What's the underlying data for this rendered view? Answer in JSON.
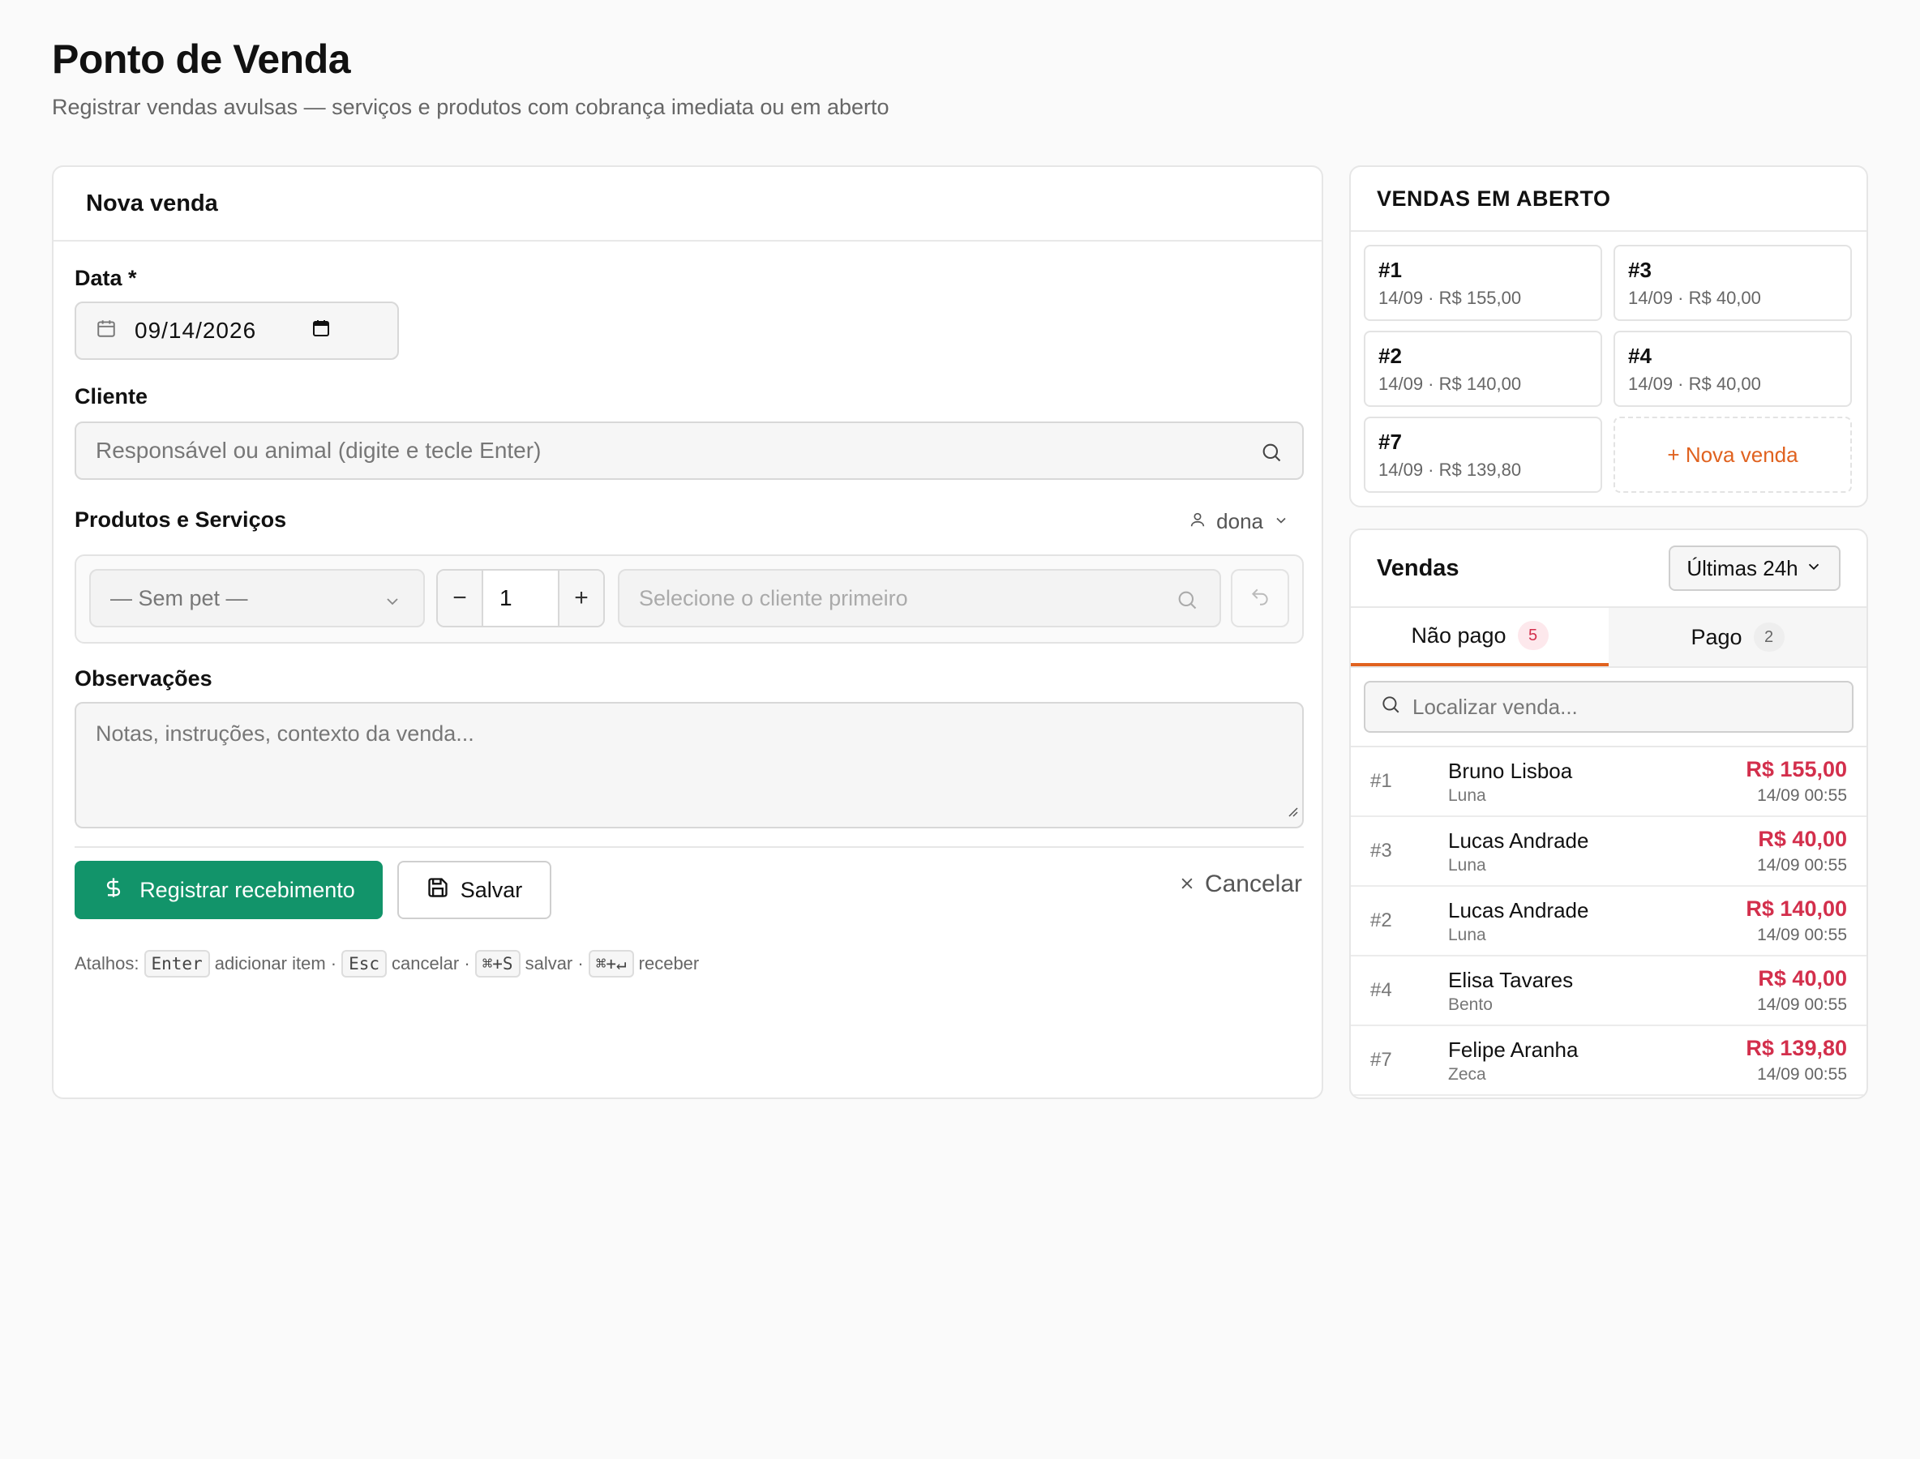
{
  "page": {
    "title": "Ponto de Venda",
    "subtitle": "Registrar vendas avulsas — serviços e produtos com cobrança imediata ou em aberto"
  },
  "new_sale": {
    "title": "Nova venda",
    "date_label": "Data *",
    "date_value": "09/14/2026",
    "client_label": "Cliente",
    "client_placeholder": "Responsável ou animal (digite e tecle Enter)",
    "items_label": "Produtos e Serviços",
    "owner_label": "dona",
    "pet_select": "— Sem pet —",
    "quantity": "1",
    "qty_minus": "−",
    "qty_plus": "+",
    "product_placeholder": "Selecione o cliente primeiro",
    "notes_label": "Observações",
    "notes_placeholder": "Notas, instruções, contexto da venda...",
    "register_label": "Registrar recebimento",
    "save_label": "Salvar",
    "cancel_label": "Cancelar",
    "shortcuts": {
      "prefix": "Atalhos:",
      "items": [
        {
          "key": "Enter",
          "text": "adicionar item ·"
        },
        {
          "key": "Esc",
          "text": "cancelar ·"
        },
        {
          "key": "⌘+S",
          "text": "salvar ·"
        },
        {
          "key": "⌘+↵",
          "text": "receber"
        }
      ]
    }
  },
  "open_sales": {
    "title": "VENDAS EM ABERTO",
    "tiles": [
      {
        "number": "#1",
        "info": "14/09 · R$ 155,00"
      },
      {
        "number": "#3",
        "info": "14/09 · R$ 40,00"
      },
      {
        "number": "#2",
        "info": "14/09 · R$ 140,00"
      },
      {
        "number": "#4",
        "info": "14/09 · R$ 40,00"
      },
      {
        "number": "#7",
        "info": "14/09 · R$ 139,80"
      }
    ],
    "new_sale_label": "+ Nova venda"
  },
  "sales": {
    "title": "Vendas",
    "period": "Últimas 24h",
    "tabs": [
      {
        "label": "Não pago",
        "count": "5"
      },
      {
        "label": "Pago",
        "count": "2"
      }
    ],
    "search_placeholder": "Localizar venda...",
    "rows": [
      {
        "id": "#1",
        "client": "Bruno Lisboa",
        "pet": "Luna",
        "amount": "R$ 155,00",
        "time": "14/09 00:55"
      },
      {
        "id": "#3",
        "client": "Lucas Andrade",
        "pet": "Luna",
        "amount": "R$ 40,00",
        "time": "14/09 00:55"
      },
      {
        "id": "#2",
        "client": "Lucas Andrade",
        "pet": "Luna",
        "amount": "R$ 140,00",
        "time": "14/09 00:55"
      },
      {
        "id": "#4",
        "client": "Elisa Tavares",
        "pet": "Bento",
        "amount": "R$ 40,00",
        "time": "14/09 00:55"
      },
      {
        "id": "#7",
        "client": "Felipe Aranha",
        "pet": "Zeca",
        "amount": "R$ 139,80",
        "time": "14/09 00:55"
      }
    ]
  },
  "colors": {
    "primary": "#12946a",
    "accent": "#e0621f",
    "unpaid": "#d32f4c"
  }
}
